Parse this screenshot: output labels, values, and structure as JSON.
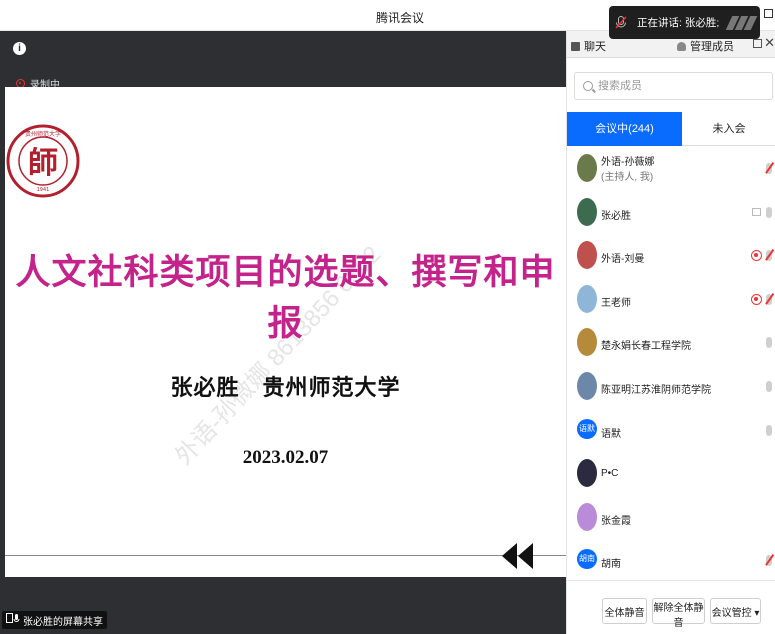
{
  "window": {
    "title": "腾讯会议"
  },
  "toast": {
    "speaking": "正在讲话: 张必胜;"
  },
  "stage": {
    "recording": "录制中",
    "share_label": "张必胜的屏幕共享"
  },
  "slide": {
    "title": "人文社科类项目的选题、撰写和申报",
    "author": "张必胜　贵州师范大学",
    "date": "2023.02.07",
    "watermark": "外语-孙微娜 8613856 6362",
    "logo_text": "贵州师范大学 GUIZHOU NORMAL UNIVERSITY 1941"
  },
  "panel": {
    "tab_chat": "聊天",
    "tab_members": "管理成员",
    "search_placeholder": "搜索成员",
    "in_meeting": "会议中(244)",
    "not_joined": "未入会",
    "members": [
      {
        "name": "外语-孙薇娜",
        "role": "(主持人, 我)",
        "avatar_color": "#6a7a4a"
      },
      {
        "name": "张必胜",
        "avatar_color": "#3d6b4f"
      },
      {
        "name": "外语-刘曼",
        "avatar_color": "#c0504d"
      },
      {
        "name": "王老师",
        "avatar_color": "#8fb6d6"
      },
      {
        "name": "楚永娟长春工程学院",
        "avatar_color": "#b58a3a"
      },
      {
        "name": "陈亚明江苏淮阴师范学院",
        "avatar_color": "#6d87a8"
      },
      {
        "name": "语默",
        "avatar_text": "语默",
        "avatar_color": "#0a6cff"
      },
      {
        "name": "P•C",
        "avatar_color": "#2b2a3f"
      },
      {
        "name": "张金霞",
        "avatar_color": "#b98bd8"
      },
      {
        "name": "胡南",
        "avatar_text": "胡南",
        "avatar_color": "#0a6cff"
      }
    ],
    "btn_mute_all": "全体静音",
    "btn_unmute_all": "解除全体静音",
    "btn_control": "会议管控 ▾"
  }
}
